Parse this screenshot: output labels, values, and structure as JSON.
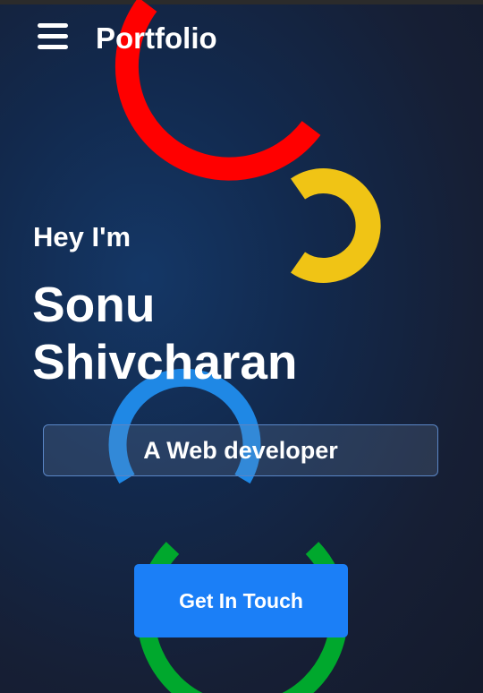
{
  "header": {
    "menu_icon": "hamburger-menu-icon",
    "brand": "Portfolio"
  },
  "hero": {
    "greeting": "Hey I'm",
    "name": "Sonu Shivcharan",
    "role": "A Web developer",
    "cta_label": "Get In Touch"
  },
  "decorations": {
    "red_ring_color": "#ff0000",
    "yellow_ring_color": "#f0c415",
    "blue_ring_color": "#1f88e5",
    "green_ring_color": "#00a82d"
  },
  "colors": {
    "background": "#12294d",
    "accent": "#1b7ff7"
  }
}
